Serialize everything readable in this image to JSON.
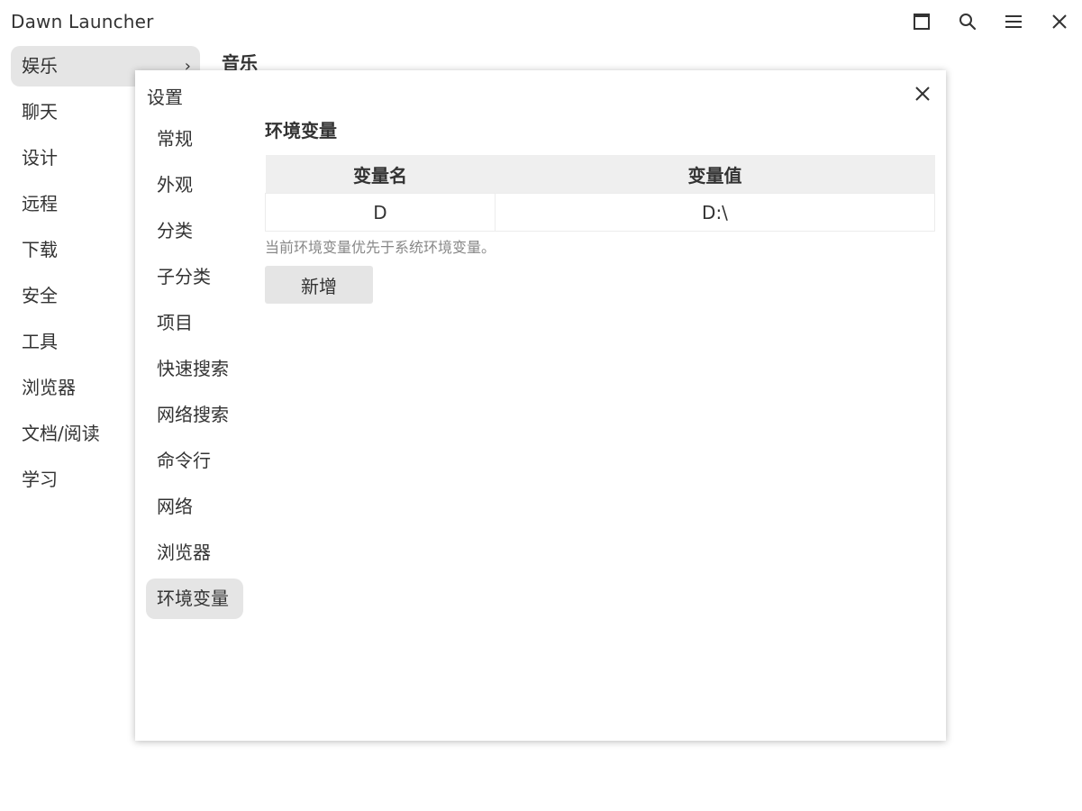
{
  "app": {
    "title": "Dawn Launcher"
  },
  "window_controls": [
    {
      "name": "maximize-icon"
    },
    {
      "name": "search-icon"
    },
    {
      "name": "menu-icon"
    },
    {
      "name": "close-icon"
    }
  ],
  "sidebar": {
    "items": [
      {
        "label": "娱乐",
        "active": true,
        "chevron": "›"
      },
      {
        "label": "聊天"
      },
      {
        "label": "设计"
      },
      {
        "label": "远程"
      },
      {
        "label": "下载"
      },
      {
        "label": "安全"
      },
      {
        "label": "工具"
      },
      {
        "label": "浏览器"
      },
      {
        "label": "文档/阅读"
      },
      {
        "label": "学习"
      }
    ]
  },
  "content": {
    "subcategory_title": "音乐"
  },
  "settings_dialog": {
    "title": "设置",
    "nav": [
      {
        "label": "常规"
      },
      {
        "label": "外观"
      },
      {
        "label": "分类"
      },
      {
        "label": "子分类"
      },
      {
        "label": "项目"
      },
      {
        "label": "快速搜索"
      },
      {
        "label": "网络搜索"
      },
      {
        "label": "命令行"
      },
      {
        "label": "网络"
      },
      {
        "label": "浏览器"
      },
      {
        "label": "环境变量",
        "active": true
      }
    ],
    "panel": {
      "heading": "环境变量",
      "table": {
        "columns": [
          "变量名",
          "变量值"
        ],
        "rows": [
          [
            "D",
            "D:\\"
          ]
        ]
      },
      "hint": "当前环境变量优先于系统环境变量。",
      "add_button": "新增"
    }
  },
  "colors": {
    "active_bg": "#e5e5e5",
    "table_header_bg": "#efefef",
    "text": "#333333",
    "hint_text": "#888888"
  }
}
